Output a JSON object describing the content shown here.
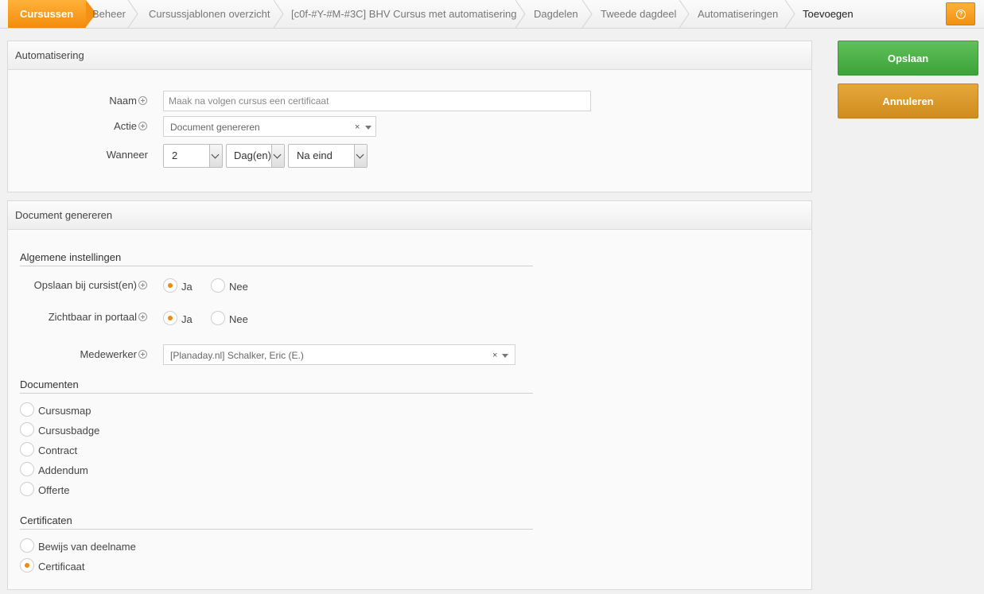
{
  "breadcrumb": {
    "items": [
      "Cursussen",
      "Beheer",
      "Cursussjablonen overzicht",
      "[c0f-#Y-#M-#3C] BHV Cursus met automatisering",
      "Dagdelen",
      "Tweede dagdeel",
      "Automatiseringen",
      "Toevoegen"
    ]
  },
  "help_icon": "help-circle-icon",
  "actions": {
    "save_label": "Opslaan",
    "cancel_label": "Annuleren",
    "save_color": "#4cb248",
    "cancel_color": "#dd9a2c"
  },
  "automation_panel": {
    "title": "Automatisering",
    "naam_label": "Naam",
    "naam_value": "Maak na volgen cursus een certificaat",
    "actie_label": "Actie",
    "actie_value": "Document genereren",
    "wanneer_label": "Wanneer",
    "wanneer_amount": "2",
    "wanneer_unit": "Dag(en)",
    "wanneer_moment": "Na eind"
  },
  "document_panel": {
    "title": "Document genereren",
    "general_title": "Algemene instellingen",
    "opslaan_label": "Opslaan bij cursist(en)",
    "zichtbaar_label": "Zichtbaar in portaal",
    "ja": "Ja",
    "nee": "Nee",
    "medewerker_label": "Medewerker",
    "medewerker_value": "[Planaday.nl] Schalker, Eric (E.)",
    "documenten_title": "Documenten",
    "documenten": [
      "Cursusmap",
      "Cursusbadge",
      "Contract",
      "Addendum",
      "Offerte"
    ],
    "certificaten_title": "Certificaten",
    "certificaten": [
      "Bewijs van deelname",
      "Certificaat"
    ]
  },
  "accent_color": "#f08a0c",
  "clear_symbol": "×"
}
